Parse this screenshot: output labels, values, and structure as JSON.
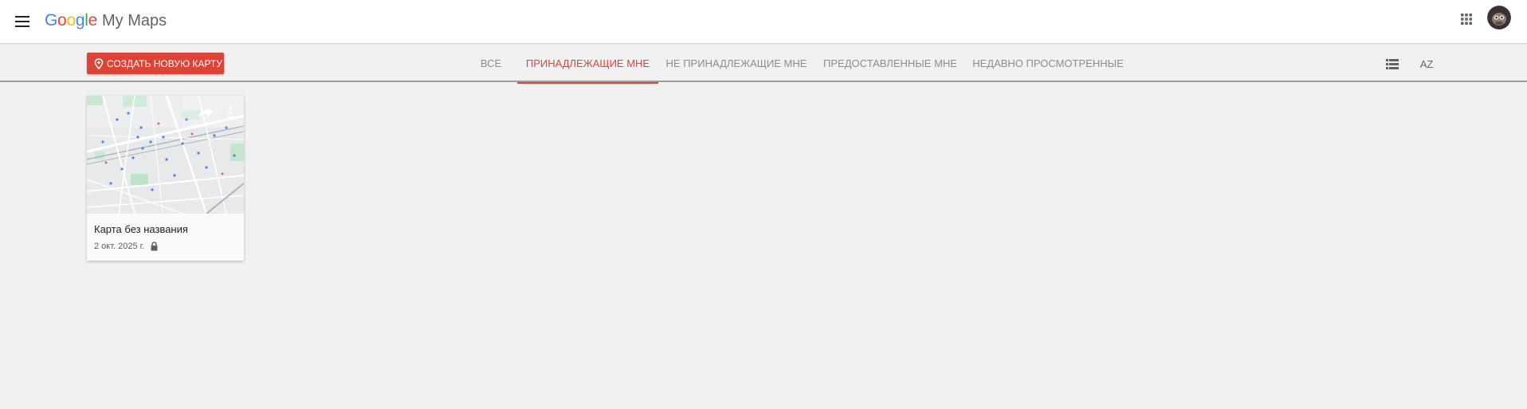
{
  "header": {
    "logo_letters": [
      "G",
      "o",
      "o",
      "g",
      "l",
      "e"
    ],
    "logo_colors": [
      "#4285f4",
      "#ea4335",
      "#fbbc05",
      "#4285f4",
      "#34a853",
      "#ea4335"
    ],
    "product_name": "My Maps",
    "menu_icon": "hamburger-menu-icon",
    "apps_icon": "apps-grid-icon",
    "avatar_icon": "user-avatar"
  },
  "toolbar": {
    "create_button_label": "СОЗДАТЬ НОВУЮ КАРТУ",
    "create_button_icon": "map-add-icon",
    "tabs": [
      {
        "label": "ВСЕ",
        "active": false
      },
      {
        "label": "ПРИНАДЛЕЖАЩИЕ МНЕ",
        "active": true
      },
      {
        "label": "НЕ ПРИНАДЛЕЖАЩИЕ МНЕ",
        "active": false
      },
      {
        "label": "ПРЕДОСТАВЛЕННЫЕ МНЕ",
        "active": false
      },
      {
        "label": "НЕДАВНО ПРОСМОТРЕННЫЕ",
        "active": false
      }
    ],
    "list_view_icon": "list-view-icon",
    "sort_label": "AZ",
    "sort_icon": "sort-az-icon"
  },
  "maps": [
    {
      "title": "Карта без названия",
      "date": "2 окт. 2025 г.",
      "thumbnail": "map-thumbnail",
      "share_icon": "share-icon",
      "more_icon": "more-vert-icon",
      "privacy_icon": "lock-icon"
    }
  ],
  "colors": {
    "accent": "#db4437",
    "background": "#f1f1f1",
    "tab_inactive": "#8d8d8d"
  }
}
